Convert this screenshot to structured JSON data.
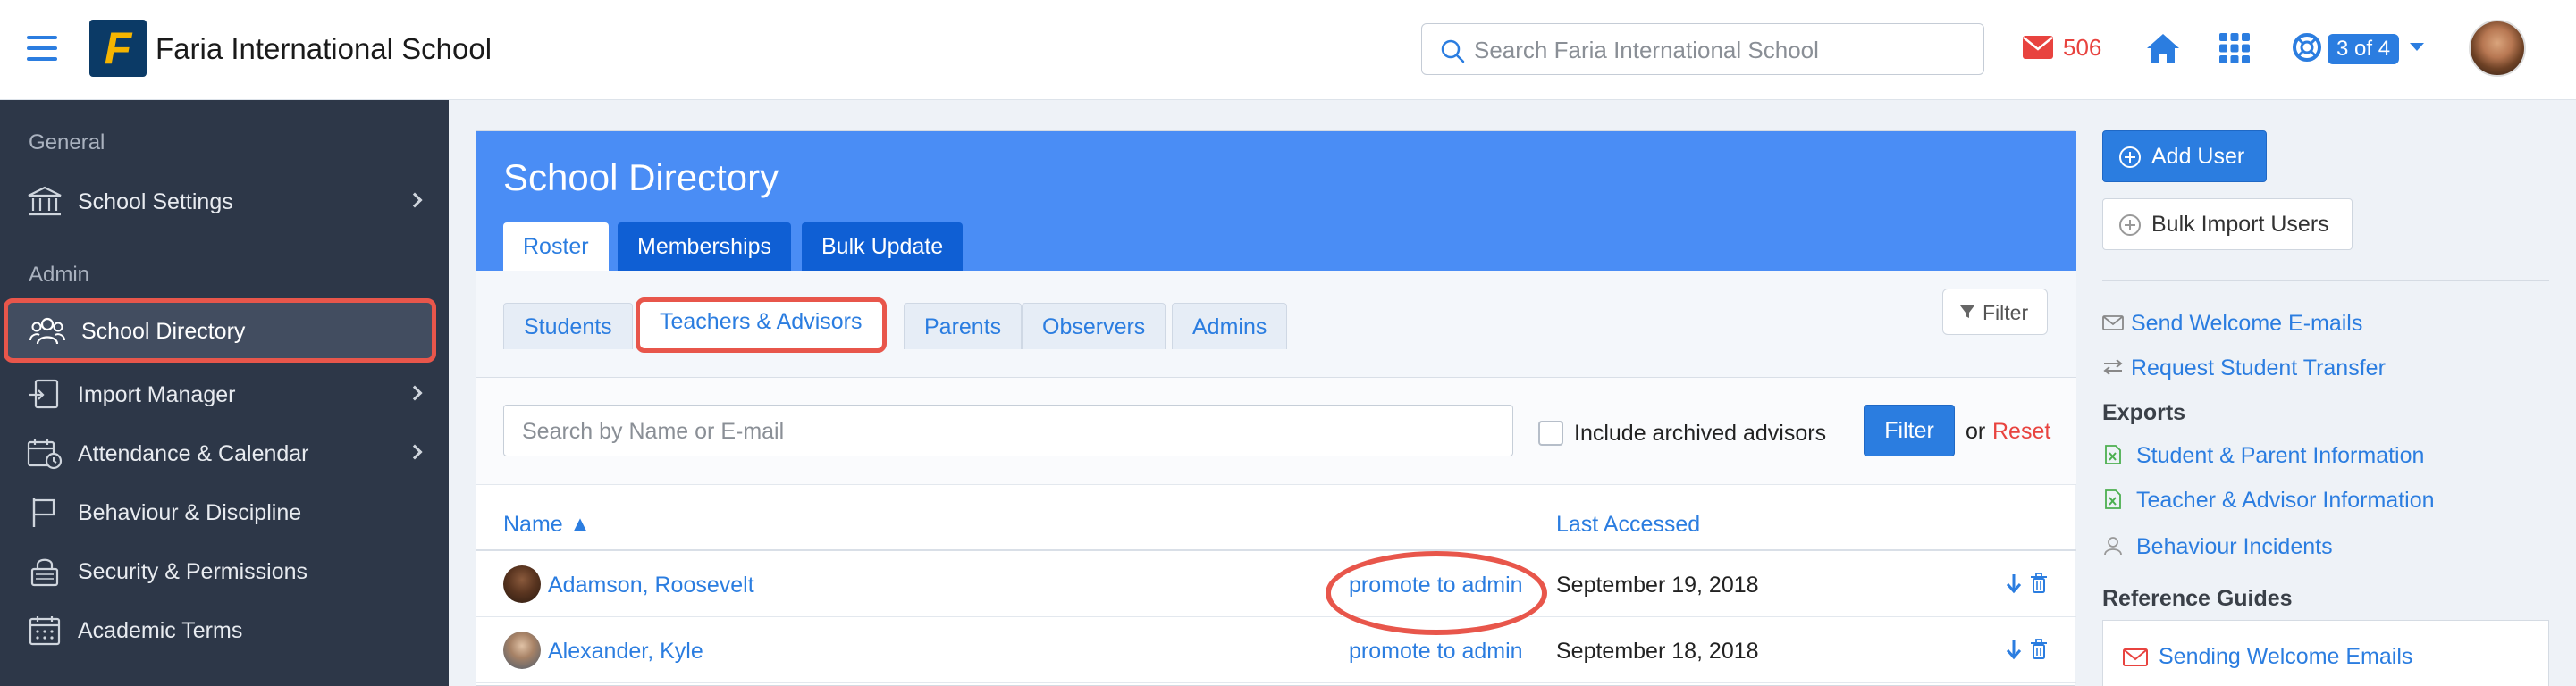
{
  "header": {
    "app_title": "Faria International School",
    "logo_letter": "F",
    "search_placeholder": "Search Faria International School",
    "mail_count": "506",
    "help_badge": "3 of 4"
  },
  "sidebar": {
    "sections": [
      {
        "label": "General"
      },
      {
        "label": "Admin"
      }
    ],
    "items": [
      {
        "label": "School Settings"
      },
      {
        "label": "School Directory"
      },
      {
        "label": "Import Manager"
      },
      {
        "label": "Attendance & Calendar"
      },
      {
        "label": "Behaviour & Discipline"
      },
      {
        "label": "Security & Permissions"
      },
      {
        "label": "Academic Terms"
      }
    ]
  },
  "main": {
    "title": "School Directory",
    "tabs": [
      {
        "label": "Roster"
      },
      {
        "label": "Memberships"
      },
      {
        "label": "Bulk Update"
      }
    ],
    "subtabs": [
      {
        "label": "Students"
      },
      {
        "label": "Teachers & Advisors"
      },
      {
        "label": "Parents"
      },
      {
        "label": "Observers"
      },
      {
        "label": "Admins"
      }
    ],
    "filter_toggle_label": "Filter",
    "name_search_placeholder": "Search by Name or E-mail",
    "include_archived_label": "Include archived advisors",
    "filter_button_label": "Filter",
    "or_text": "or",
    "reset_label": "Reset",
    "columns": {
      "name": "Name ▲",
      "last_accessed": "Last Accessed"
    },
    "rows": [
      {
        "name": "Adamson, Roosevelt",
        "action": "promote to admin",
        "last_accessed": "September 19, 2018"
      },
      {
        "name": "Alexander, Kyle",
        "action": "promote to admin",
        "last_accessed": "September 18, 2018"
      }
    ]
  },
  "right": {
    "add_user_label": "Add User",
    "bulk_import_label": "Bulk Import Users",
    "send_welcome_label": "Send Welcome E-mails",
    "request_transfer_label": "Request Student Transfer",
    "exports_heading": "Exports",
    "exports": [
      {
        "label": "Student & Parent Information"
      },
      {
        "label": "Teacher & Advisor Information"
      },
      {
        "label": "Behaviour Incidents"
      }
    ],
    "reference_heading": "Reference Guides",
    "reference_guides": [
      {
        "label": "Sending Welcome Emails"
      }
    ]
  },
  "colors": {
    "accent": "#2b7de0",
    "header_blue": "#4a8df5",
    "sidebar_bg": "#2d3748",
    "highlight_red": "#e8564b"
  }
}
